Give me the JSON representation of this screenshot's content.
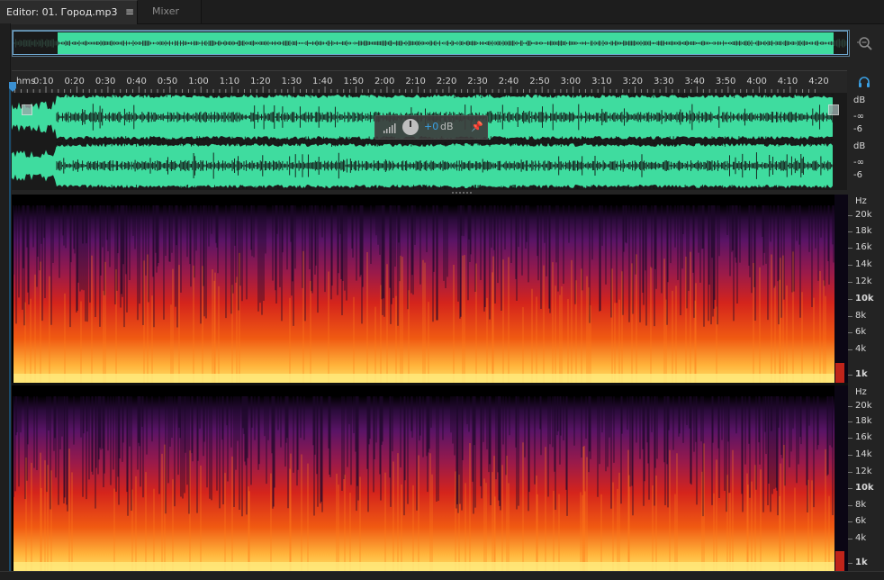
{
  "tabs": {
    "editor_label": "Editor: 01. Город.mp3",
    "menu_glyph": "≡",
    "mixer_label": "Mixer"
  },
  "ruler": {
    "unit": "hms",
    "ticks": [
      "0:10",
      "0:20",
      "0:30",
      "0:40",
      "0:50",
      "1:00",
      "1:10",
      "1:20",
      "1:30",
      "1:40",
      "1:50",
      "2:00",
      "2:10",
      "2:20",
      "2:30",
      "2:40",
      "2:50",
      "3:00",
      "3:10",
      "3:20",
      "3:30",
      "3:40",
      "3:50",
      "4:00",
      "4:10",
      "4:20"
    ]
  },
  "hud": {
    "value": "+0",
    "unit": "dB"
  },
  "amplitude_scale": {
    "ch1": {
      "unit": "dB",
      "inf": "-∞",
      "six": "-6"
    },
    "ch2": {
      "unit": "dB",
      "inf": "-∞",
      "six": "-6"
    }
  },
  "frequency_scale": {
    "unit": "Hz",
    "labels": [
      "20k",
      "18k",
      "16k",
      "14k",
      "12k",
      "10k",
      "8k",
      "6k",
      "4k",
      "1k"
    ]
  },
  "icons": {
    "zoom": "zoom-icon",
    "headphones": "headphone-icon",
    "volume": "volume-icon",
    "pin": "pin-icon",
    "playhead": "playhead-icon"
  },
  "colors": {
    "waveform": "#3fdc9f",
    "accent": "#3aa0e4",
    "spectral_low": "#ffe36a",
    "spectral_mid": "#e32614",
    "spectral_high": "#46126a"
  }
}
